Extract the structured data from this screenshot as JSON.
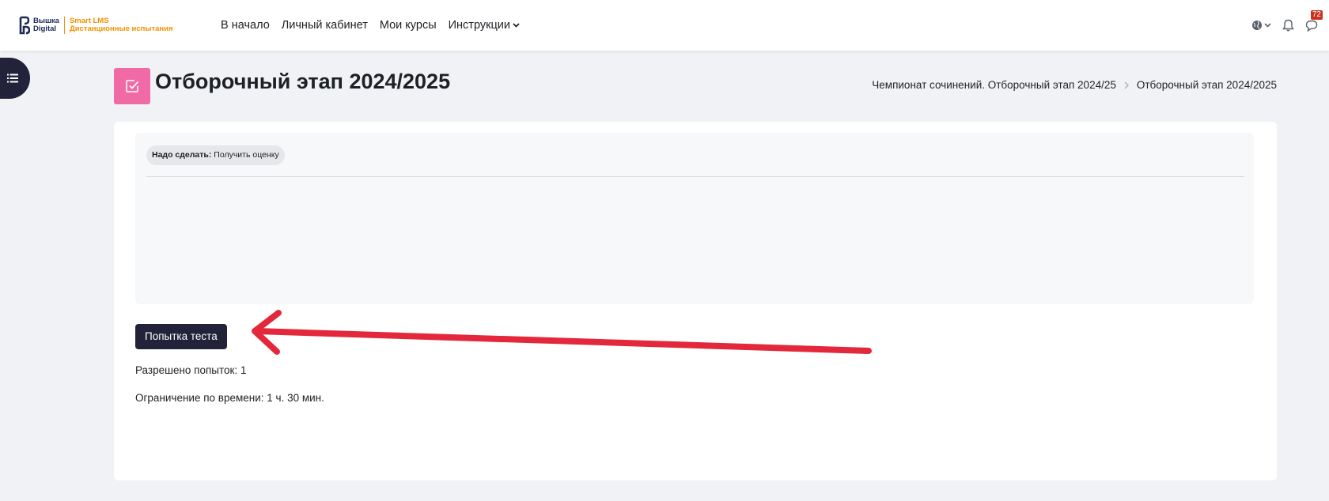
{
  "brand": {
    "name_line1": "Вышка",
    "name_line2": "Digital",
    "product_line1": "Smart LMS",
    "product_line2": "Дистанционные испытания",
    "accent_color": "#f29100",
    "navy_color": "#1e2a5a"
  },
  "nav": {
    "items": [
      {
        "label": "В начало"
      },
      {
        "label": "Личный кабинет"
      },
      {
        "label": "Мои курсы"
      },
      {
        "label": "Инструкции",
        "dropdown": true
      }
    ]
  },
  "header_icons": {
    "language": "globe-icon",
    "notifications": "bell-icon",
    "messages": "chat-icon",
    "messages_badge": "72"
  },
  "drawer_toggle": {
    "icon": "list-icon"
  },
  "page": {
    "icon": "checkbox-icon",
    "icon_color": "#f06ba6",
    "title": "Отборочный этап 2024/2025"
  },
  "breadcrumb": {
    "items": [
      {
        "label": "Чемпионат сочинений. Отборочный этап 2024/25"
      },
      {
        "label": "Отборочный этап 2024/2025"
      }
    ]
  },
  "completion": {
    "prefix": "Надо сделать:",
    "value": "Получить оценку"
  },
  "quiz": {
    "attempt_button": "Попытка теста",
    "attempts_allowed": "Разрешено попыток: 1",
    "time_limit": "Ограничение по времени: 1 ч. 30 мин.",
    "button_color": "#22223b"
  },
  "annotation": {
    "arrow_color": "#e3283c"
  }
}
